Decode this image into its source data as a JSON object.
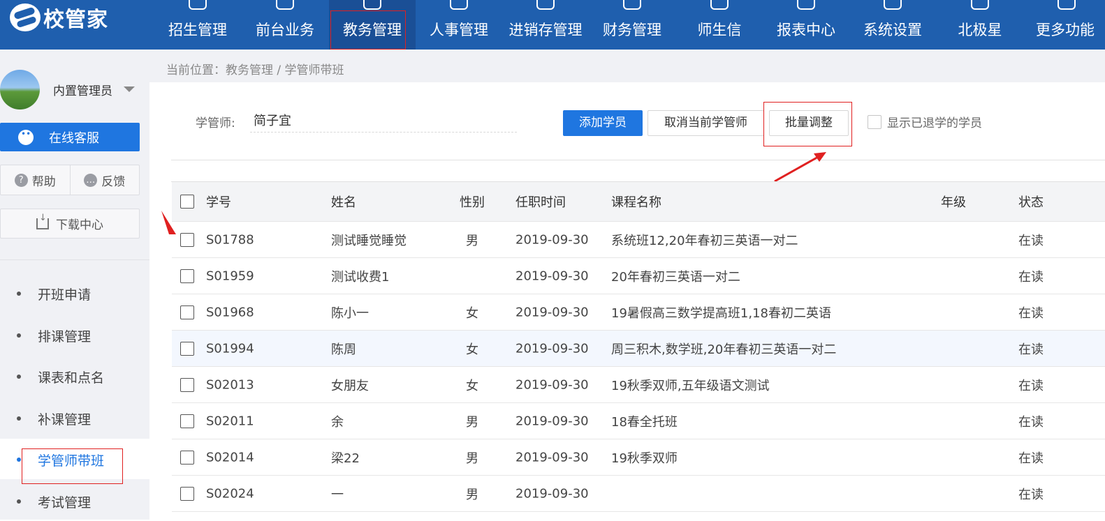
{
  "app": {
    "logo_text": "校管家"
  },
  "nav": {
    "items": [
      {
        "label": "招生管理",
        "icon": "user-plus-icon"
      },
      {
        "label": "前台业务",
        "icon": "book-icon"
      },
      {
        "label": "教务管理",
        "icon": "document-icon",
        "active": true
      },
      {
        "label": "人事管理",
        "icon": "person-icon"
      },
      {
        "label": "进销存管理",
        "icon": "inbox-arrow-icon"
      },
      {
        "label": "财务管理",
        "icon": "yen-icon"
      },
      {
        "label": "师生信",
        "icon": "chat-icon"
      },
      {
        "label": "报表中心",
        "icon": "chart-icon"
      },
      {
        "label": "系统设置",
        "icon": "gear-icon"
      },
      {
        "label": "北极星",
        "icon": "star-icon"
      },
      {
        "label": "更多功能",
        "icon": "more-icon"
      }
    ]
  },
  "sidebar": {
    "admin_name": "内置管理员",
    "service_label": "在线客服",
    "help_label": "帮助",
    "feedback_label": "反馈",
    "download_label": "下载中心",
    "menu": [
      {
        "label": "开班申请"
      },
      {
        "label": "排课管理"
      },
      {
        "label": "课表和点名"
      },
      {
        "label": "补课管理"
      },
      {
        "label": "学管师带班",
        "active": true
      },
      {
        "label": "考试管理"
      }
    ]
  },
  "breadcrumb": "当前位置：教务管理 / 学管师带班",
  "toolbar": {
    "tutor_label": "学管师:",
    "tutor_value": "简子宜",
    "add_label": "添加学员",
    "cancel_label": "取消当前学管师",
    "batch_label": "批量调整",
    "show_left_label": "显示已退学的学员"
  },
  "table": {
    "headers": {
      "no": "学号",
      "name": "姓名",
      "gender": "性别",
      "date": "任职时间",
      "course": "课程名称",
      "grade": "年级",
      "status": "状态"
    },
    "rows": [
      {
        "no": "S01788",
        "name": "测试睡觉睡觉",
        "gender": "男",
        "date": "2019-09-30",
        "course": "系统班12,20年春初三英语一对二",
        "grade": "",
        "status": "在读"
      },
      {
        "no": "S01959",
        "name": "测试收费1",
        "gender": "",
        "date": "2019-09-30",
        "course": "20年春初三英语一对二",
        "grade": "",
        "status": "在读"
      },
      {
        "no": "S01968",
        "name": "陈小一",
        "gender": "女",
        "date": "2019-09-30",
        "course": "19暑假高三数学提高班1,18春初二英语",
        "grade": "",
        "status": "在读"
      },
      {
        "no": "S01994",
        "name": "陈周",
        "gender": "女",
        "date": "2019-09-30",
        "course": "周三积木,数学班,20年春初三英语一对二",
        "grade": "",
        "status": "在读"
      },
      {
        "no": "S02013",
        "name": "女朋友",
        "gender": "女",
        "date": "2019-09-30",
        "course": "19秋季双师,五年级语文测试",
        "grade": "",
        "status": "在读"
      },
      {
        "no": "S02011",
        "name": "余",
        "gender": "男",
        "date": "2019-09-30",
        "course": "18春全托班",
        "grade": "",
        "status": "在读"
      },
      {
        "no": "S02014",
        "name": "梁22",
        "gender": "男",
        "date": "2019-09-30",
        "course": "19秋季双师",
        "grade": "",
        "status": "在读"
      },
      {
        "no": "S02024",
        "name": "一",
        "gender": "男",
        "date": "2019-09-30",
        "course": "",
        "grade": "",
        "status": "在读"
      }
    ]
  },
  "colors": {
    "nav_bg": "#1f5fae",
    "accent": "#1f76e0",
    "annotation_red": "#e02020"
  }
}
